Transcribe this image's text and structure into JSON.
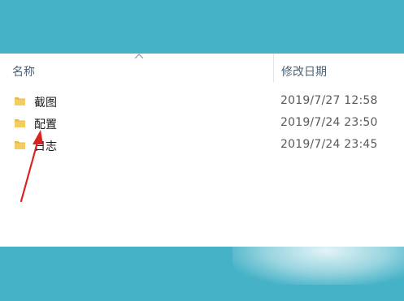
{
  "header": {
    "name_label": "名称",
    "date_label": "修改日期"
  },
  "files": [
    {
      "name": "截图",
      "date": "2019/7/27 12:58",
      "icon": "folder-icon"
    },
    {
      "name": "配置",
      "date": "2019/7/24 23:50",
      "icon": "folder-icon"
    },
    {
      "name": "日志",
      "date": "2019/7/24 23:45",
      "icon": "folder-icon"
    }
  ],
  "colors": {
    "band": "#45b2c7",
    "folder": "#e8b84b",
    "annotation_arrow": "#d9231f"
  },
  "annotation": {
    "type": "red-arrow",
    "points_to": "配置"
  }
}
